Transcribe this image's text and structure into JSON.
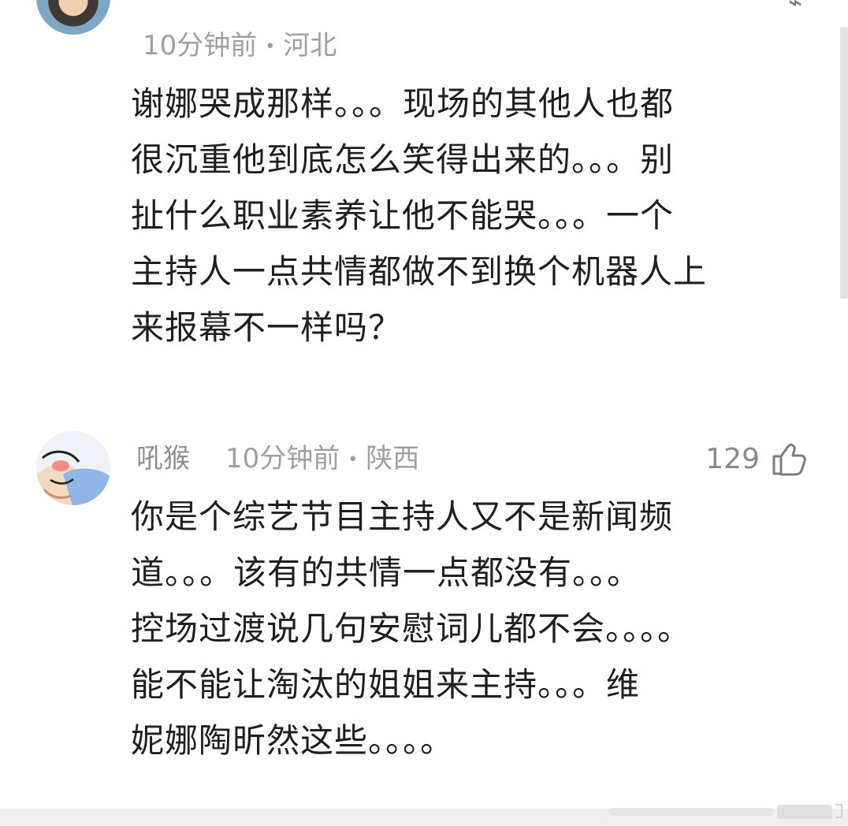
{
  "comments": [
    {
      "username": "",
      "time": "10分钟前",
      "location": "河北",
      "lines": [
        "谢娜哭成那样。。。现场的其他人也都",
        "很沉重他到底怎么笑得出来的。。。别",
        "扯什么职业素养让他不能哭。。。一个",
        "主持人一点共情都做不到换个机器人上",
        "来报幕不一样吗？"
      ]
    },
    {
      "username": "吼猴",
      "time": "10分钟前",
      "location": "陕西",
      "likes": "129",
      "lines": [
        "你是个综艺节目主持人又不是新闻频",
        "道。。。该有的共情一点都没有。。。",
        "控场过渡说几句安慰词儿都不会。。。。",
        "能不能让淘汰的姐姐来主持。。。维",
        "妮娜陶昕然这些。。。。"
      ]
    }
  ],
  "meta_separator": "•",
  "icons": {
    "like": "thumbs-up-icon"
  },
  "colors": {
    "meta_text": "#a0a0a0",
    "body_text": "#1f1f1f",
    "like_gray": "#8a8a8a"
  }
}
